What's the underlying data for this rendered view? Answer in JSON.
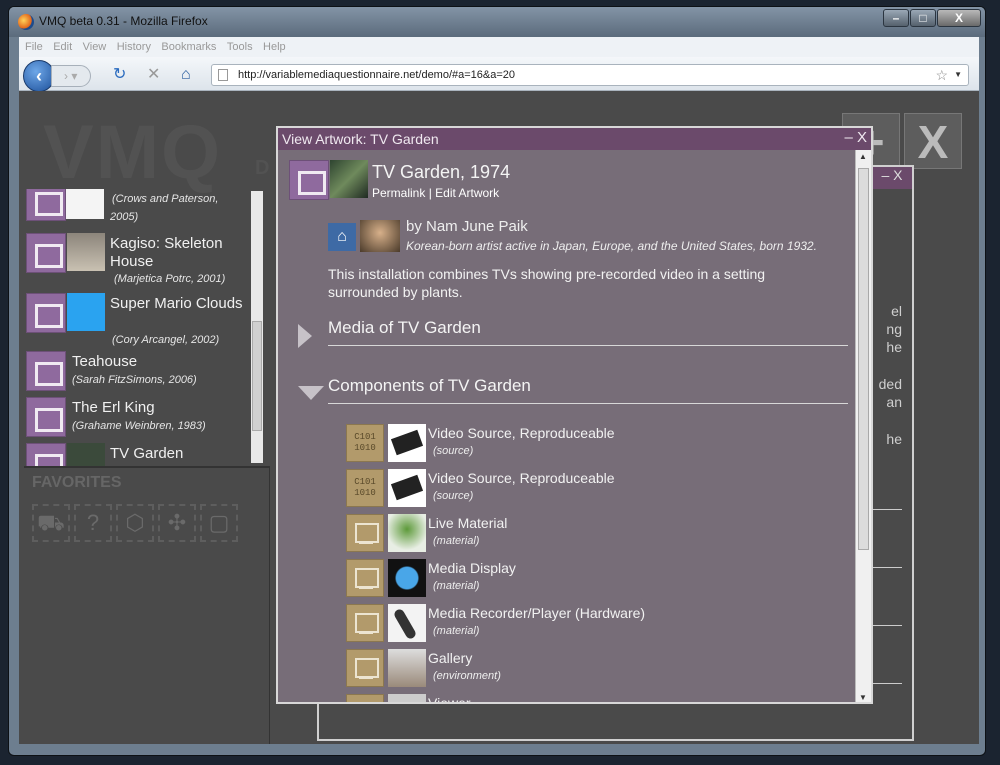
{
  "browser": {
    "title": "VMQ beta 0.31 - Mozilla Firefox",
    "menu": [
      "File",
      "Edit",
      "View",
      "History",
      "Bookmarks",
      "Tools",
      "Help"
    ],
    "url": "http://variablemediaquestionnaire.net/demo/#a=16&a=20"
  },
  "app": {
    "logo": "VMQ",
    "logo_sub": "D"
  },
  "sidebar": {
    "items": [
      {
        "title": "",
        "sub": "(Crows and Paterson,",
        "sub2": "2005)"
      },
      {
        "title": "Kagiso: Skeleton House",
        "sub": "(Marjetica Potrc, 2001)"
      },
      {
        "title": "Super Mario Clouds",
        "sub": "(Cory Arcangel, 2002)"
      },
      {
        "title": "Teahouse",
        "sub": "(Sarah FitzSimons, 2006)"
      },
      {
        "title": "The Erl King",
        "sub": "(Grahame Weinbren, 1983)"
      },
      {
        "title": "TV Garden",
        "sub": ""
      }
    ],
    "favorites_label": "FAVORITES"
  },
  "back_modal": {
    "close": "– X",
    "ghost_lines": [
      "el",
      "ng",
      "he",
      "ded",
      "an",
      "he"
    ]
  },
  "modal": {
    "title": "View Artwork: TV Garden",
    "close": "– X",
    "artwork_title": "TV Garden, 1974",
    "permalink": "Permalink",
    "sep": " | ",
    "edit": "Edit Artwork",
    "by": "by Nam June Paik",
    "bio": "Korean-born artist active in Japan, Europe, and the United States, born 1932.",
    "description": "This installation combines TVs showing pre-recorded video in a setting surrounded by plants.",
    "media_section": "Media of TV Garden",
    "components_section": "Components of TV Garden",
    "components": [
      {
        "name": "Video Source, Reproduceable",
        "type": "(source)",
        "icon": "binary"
      },
      {
        "name": "Video Source, Reproduceable",
        "type": "(source)",
        "icon": "binary"
      },
      {
        "name": "Live Material",
        "type": "(material)",
        "icon": "terminal"
      },
      {
        "name": "Media Display",
        "type": "(material)",
        "icon": "terminal"
      },
      {
        "name": "Media Recorder/Player (Hardware)",
        "type": "(material)",
        "icon": "terminal"
      },
      {
        "name": "Gallery",
        "type": "(environment)",
        "icon": "frame"
      },
      {
        "name": "Viewer",
        "type": "",
        "icon": "terminal"
      }
    ],
    "binary_text": "C101 1010"
  }
}
